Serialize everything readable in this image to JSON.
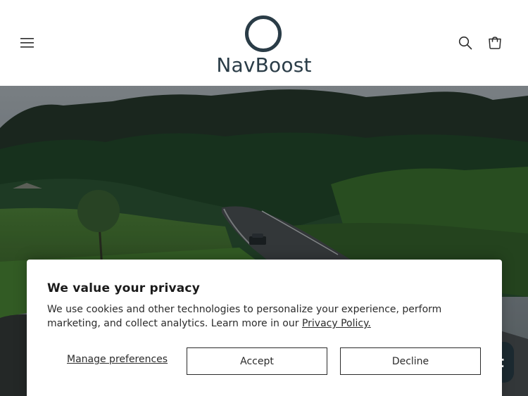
{
  "header": {
    "menu_icon": "hamburger-menu-icon",
    "logo_text": "NavBoost",
    "search_icon": "search-icon",
    "cart_icon": "cart-icon"
  },
  "hero": {
    "image": "scenic road through green hills"
  },
  "chat_widget": {
    "label": "t"
  },
  "cookie_banner": {
    "title": "We value your privacy",
    "body": "We use cookies and other technologies to personalize your experience, perform marketing, and collect analytics. Learn more in our",
    "link": "Privacy Policy.",
    "manage": "Manage preferences",
    "accept": "Accept",
    "decline": "Decline"
  },
  "colors": {
    "logo": "#2a3c47",
    "text": "#2b2b2b",
    "chat_bg": "#1c2a31"
  }
}
